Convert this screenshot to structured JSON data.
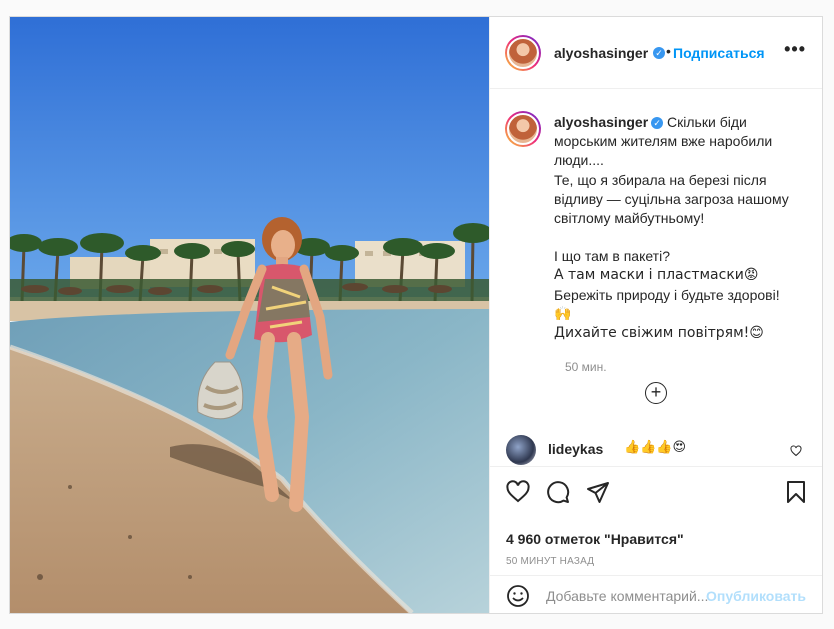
{
  "post": {
    "username": "alyoshasinger",
    "verified_mark": "✓",
    "follow_label": "Подписаться",
    "more_label": "•••",
    "caption_lines": [
      "Скільки біди",
      "морським жителям вже наробили",
      "люди....",
      "Те, що я збирала на березі після",
      "відливу — суцільна загроза нашому",
      "світлому майбутньому!",
      "",
      "І що там в пакеті?",
      "А там маски і пластмаски😡",
      "Бережіть природу і будьте здорові!",
      "🙌",
      "Дихайте свіжим повітрям!😊"
    ],
    "caption_time": "50 мин.",
    "load_more_label": "+",
    "comment": {
      "username": "lideykas",
      "text": "👍👍👍😍"
    },
    "likes_text": "4 960 отметок \"Нравится\"",
    "time_ago": "50 МИНУТ НАЗАД",
    "add_comment_placeholder": "Добавьте комментарий...",
    "publish_label": "Опубликовать"
  },
  "icons": {
    "avatar": "avatar-image",
    "like": "heart-icon",
    "comment": "comment-bubble-icon",
    "share": "paper-plane-icon",
    "save": "bookmark-icon",
    "emoji": "smiley-icon",
    "comment_like": "small-heart-icon",
    "more": "ellipsis-icon"
  },
  "colors": {
    "accent": "#0095f6",
    "publish_disabled": "#b2dffc",
    "muted_text": "#8e8e8e",
    "border": "#dbdbdb",
    "verified": "#3897f0"
  }
}
